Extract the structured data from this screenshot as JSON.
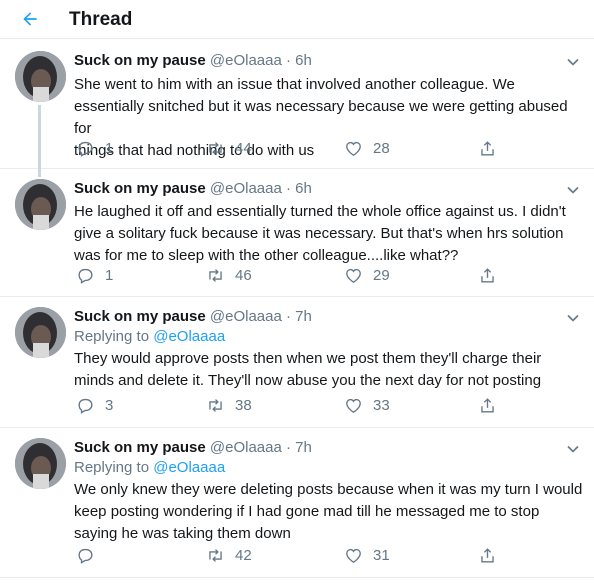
{
  "header": {
    "title": "Thread"
  },
  "tweets": [
    {
      "name": "Suck on my pause",
      "handle": "@eOlaaaa",
      "time": "· 6h",
      "reply_prefix": "",
      "reply_handle": "",
      "lines": [
        "She went to him with an issue that involved another colleague. We",
        "essentially snitched but it was necessary because we were getting abused for",
        "things that had nothing to do with us"
      ],
      "replies": "1",
      "retweets": "44",
      "likes": "28"
    },
    {
      "name": "Suck on my pause",
      "handle": "@eOlaaaa",
      "time": "· 6h",
      "reply_prefix": "",
      "reply_handle": "",
      "lines": [
        "He laughed it off and essentially turned the whole office against us. I didn't",
        "give a solitary fuck because it was necessary. But that's when hrs solution",
        "was for me to sleep with the other colleague....like what??"
      ],
      "replies": "1",
      "retweets": "46",
      "likes": "29"
    },
    {
      "name": "Suck on my pause",
      "handle": "@eOlaaaa",
      "time": "· 7h",
      "reply_prefix": "Replying to",
      "reply_handle": "@eOlaaaa",
      "lines": [
        "They would approve posts then when we post them they'll charge their",
        "minds and delete it. They'll now abuse you the next day for not posting"
      ],
      "replies": "3",
      "retweets": "38",
      "likes": "33"
    },
    {
      "name": "Suck on my pause",
      "handle": "@eOlaaaa",
      "time": "· 7h",
      "reply_prefix": "Replying to",
      "reply_handle": "@eOlaaaa",
      "lines": [
        "We only knew they were deleting posts because when it was my turn I would",
        "keep posting wondering if I had gone mad till he messaged me to stop",
        "saying he was taking them down"
      ],
      "replies": "",
      "retweets": "42",
      "likes": "31"
    }
  ],
  "icons": {
    "back": "arrow-left-icon",
    "chevron": "chevron-down-icon",
    "reply": "reply-icon",
    "retweet": "retweet-icon",
    "like": "heart-icon",
    "share": "share-icon"
  },
  "colors": {
    "accent": "#1da1f2",
    "muted": "#657786",
    "border": "#e6ecf0",
    "text": "#14171a"
  }
}
